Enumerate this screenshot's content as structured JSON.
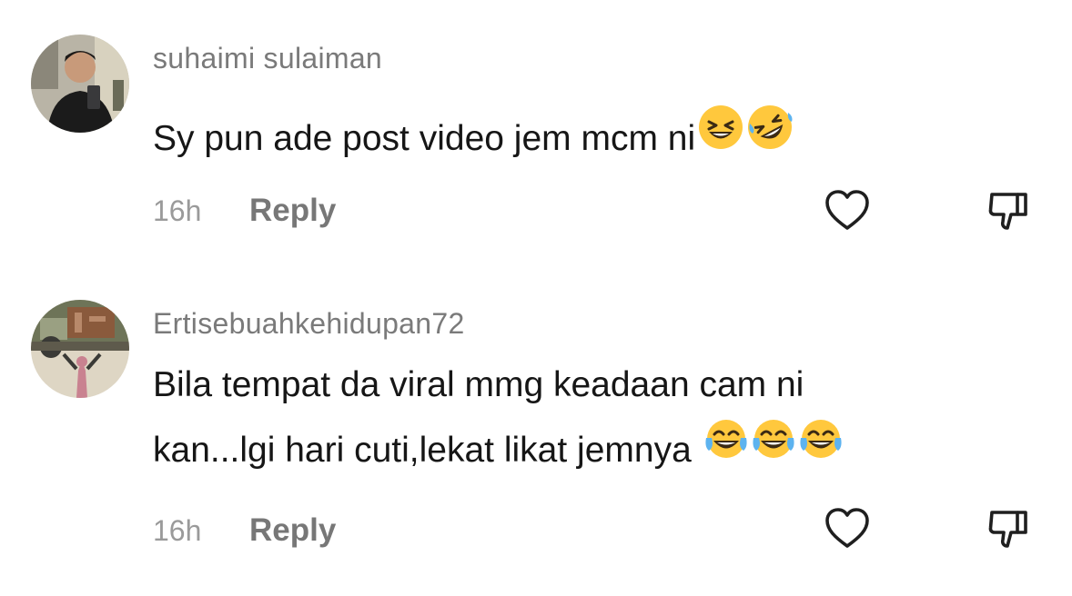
{
  "comments": [
    {
      "username": "suhaimi sulaiman",
      "text": "Sy pun ade post video jem mcm ni",
      "emojis": [
        "grinning-squinting-emoji",
        "rolling-on-floor-laughing-emoji"
      ],
      "time": "16h",
      "reply_label": "Reply"
    },
    {
      "username": "Ertisebuahkehidupan72",
      "text_line1": "Bila tempat da viral mmg keadaan cam ni",
      "text_line2": "kan...lgi hari cuti,lekat likat jemnya",
      "emojis": [
        "tears-of-joy-emoji",
        "tears-of-joy-emoji",
        "tears-of-joy-emoji"
      ],
      "time": "16h",
      "reply_label": "Reply"
    }
  ],
  "colors": {
    "username": "#7a7a7a",
    "text": "#161616",
    "time": "#9a9a9a",
    "reply": "#777777",
    "emoji_yellow": "#ffc83d"
  },
  "icons": [
    "heart-outline-icon",
    "thumbs-down-outline-icon"
  ]
}
